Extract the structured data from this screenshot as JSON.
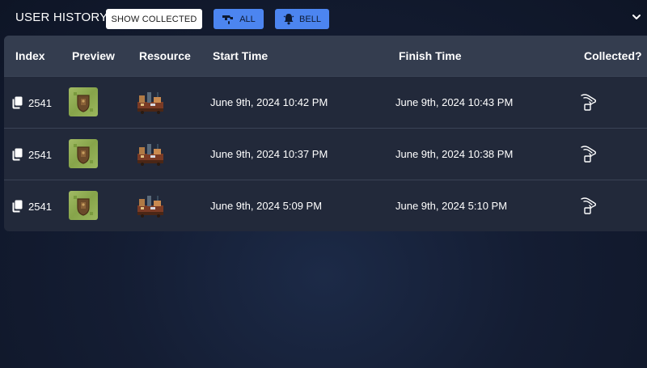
{
  "header": {
    "title": "USER HISTORY",
    "show_collected_label": "SHOW COLLECTED",
    "all_label": "ALL",
    "bell_label": "BELL"
  },
  "table": {
    "columns": [
      "Index",
      "Preview",
      "Resource",
      "Start Time",
      "Finish Time",
      "Collected?"
    ],
    "rows": [
      {
        "index": "2541",
        "start": "June 9th, 2024 10:42 PM",
        "finish": "June 9th, 2024 10:43 PM"
      },
      {
        "index": "2541",
        "start": "June 9th, 2024 10:37 PM",
        "finish": "June 9th, 2024 10:38 PM"
      },
      {
        "index": "2541",
        "start": "June 9th, 2024 5:09 PM",
        "finish": "June 9th, 2024 5:10 PM"
      }
    ]
  },
  "icons": {
    "index_icon": "copy-icon",
    "collected_icon": "hand-tap-icon",
    "all_icon": "faucet-icon",
    "bell_icon": "bell-icon",
    "collapse_icon": "chevron-down-icon"
  },
  "colors": {
    "accent": "#4c85f0",
    "header_row": "#343d4f",
    "table_body": "#22293a",
    "page_background": "#141d33"
  }
}
